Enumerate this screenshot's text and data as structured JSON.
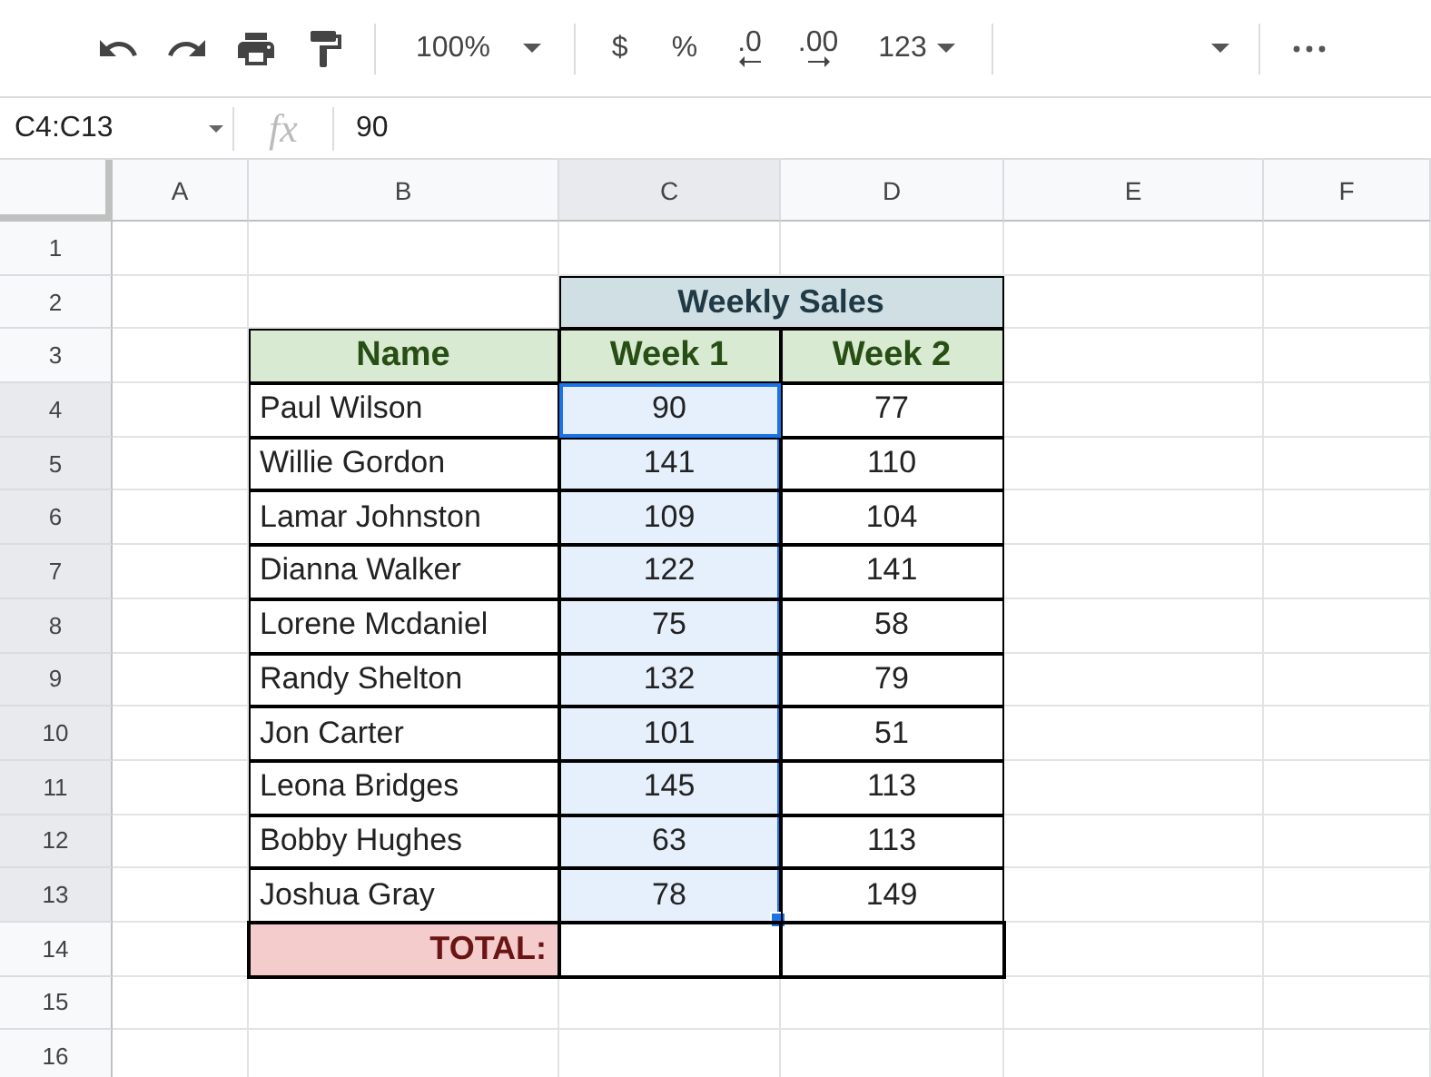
{
  "toolbar": {
    "zoom": "100%",
    "currency": "$",
    "percent": "%",
    "decrease_decimals": ".0",
    "increase_decimals": ".00",
    "number_format": "123"
  },
  "name_box": {
    "value": "C4:C13"
  },
  "formula_bar": {
    "function_label": "fx",
    "value": "90"
  },
  "columns": [
    {
      "label": "A",
      "selected": false
    },
    {
      "label": "B",
      "selected": false
    },
    {
      "label": "C",
      "selected": true
    },
    {
      "label": "D",
      "selected": false
    },
    {
      "label": "E",
      "selected": false
    },
    {
      "label": "F",
      "selected": false
    }
  ],
  "row_headers": [
    {
      "label": "1",
      "selected": false
    },
    {
      "label": "2",
      "selected": false
    },
    {
      "label": "3",
      "selected": false
    },
    {
      "label": "4",
      "selected": true
    },
    {
      "label": "5",
      "selected": true
    },
    {
      "label": "6",
      "selected": true
    },
    {
      "label": "7",
      "selected": true
    },
    {
      "label": "8",
      "selected": true
    },
    {
      "label": "9",
      "selected": true
    },
    {
      "label": "10",
      "selected": true
    },
    {
      "label": "11",
      "selected": true
    },
    {
      "label": "12",
      "selected": true
    },
    {
      "label": "13",
      "selected": true
    },
    {
      "label": "14",
      "selected": false
    },
    {
      "label": "15",
      "selected": false
    },
    {
      "label": "16",
      "selected": false
    }
  ],
  "table": {
    "group_header": "Weekly Sales",
    "columns": [
      "Name",
      "Week 1",
      "Week 2"
    ],
    "rows": [
      {
        "name": "Paul Wilson",
        "week_1": "90",
        "week_2": "77",
        "selected": true,
        "active": true
      },
      {
        "name": "Willie Gordon",
        "week_1": "141",
        "week_2": "110",
        "selected": true,
        "active": false
      },
      {
        "name": "Lamar Johnston",
        "week_1": "109",
        "week_2": "104",
        "selected": true,
        "active": false
      },
      {
        "name": "Dianna Walker",
        "week_1": "122",
        "week_2": "141",
        "selected": true,
        "active": false
      },
      {
        "name": "Lorene Mcdaniel",
        "week_1": "75",
        "week_2": "58",
        "selected": true,
        "active": false
      },
      {
        "name": "Randy Shelton",
        "week_1": "132",
        "week_2": "79",
        "selected": true,
        "active": false
      },
      {
        "name": "Jon Carter",
        "week_1": "101",
        "week_2": "51",
        "selected": true,
        "active": false
      },
      {
        "name": "Leona Bridges",
        "week_1": "145",
        "week_2": "113",
        "selected": true,
        "active": false
      },
      {
        "name": "Bobby Hughes",
        "week_1": "63",
        "week_2": "113",
        "selected": true,
        "active": false
      },
      {
        "name": "Joshua Gray",
        "week_1": "78",
        "week_2": "149",
        "selected": true,
        "active": false
      }
    ],
    "total_label": "TOTAL:"
  }
}
